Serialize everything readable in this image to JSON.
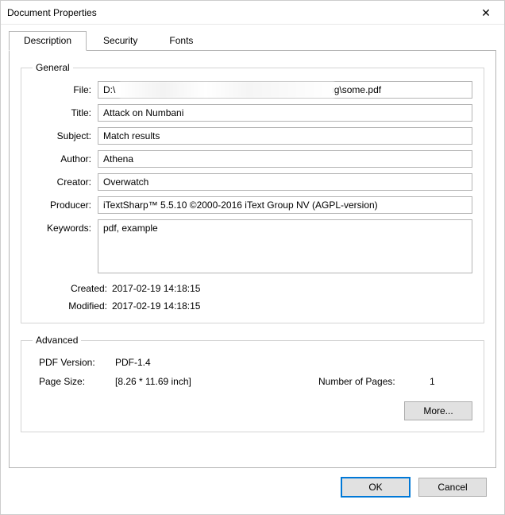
{
  "window": {
    "title": "Document Properties"
  },
  "tabs": {
    "description": "Description",
    "security": "Security",
    "fonts": "Fonts"
  },
  "general": {
    "legend": "General",
    "labels": {
      "file": "File:",
      "title": "Title:",
      "subject": "Subject:",
      "author": "Author:",
      "creator": "Creator:",
      "producer": "Producer:",
      "keywords": "Keywords:",
      "created": "Created:",
      "modified": "Modified:"
    },
    "values": {
      "file": "D:\\                                                                          Debug\\some.pdf",
      "title": "Attack on Numbani",
      "subject": "Match results",
      "author": "Athena",
      "creator": "Overwatch",
      "producer": "iTextSharp™ 5.5.10 ©2000-2016 iText Group NV (AGPL-version)",
      "keywords": "pdf, example",
      "created": "2017-02-19 14:18:15",
      "modified": "2017-02-19 14:18:15"
    }
  },
  "advanced": {
    "legend": "Advanced",
    "labels": {
      "pdf_version": "PDF Version:",
      "page_size": "Page Size:",
      "num_pages": "Number of Pages:"
    },
    "values": {
      "pdf_version": "PDF-1.4",
      "page_size": "[8.26 * 11.69 inch]",
      "num_pages": "1"
    },
    "more_label": "More..."
  },
  "footer": {
    "ok": "OK",
    "cancel": "Cancel"
  }
}
